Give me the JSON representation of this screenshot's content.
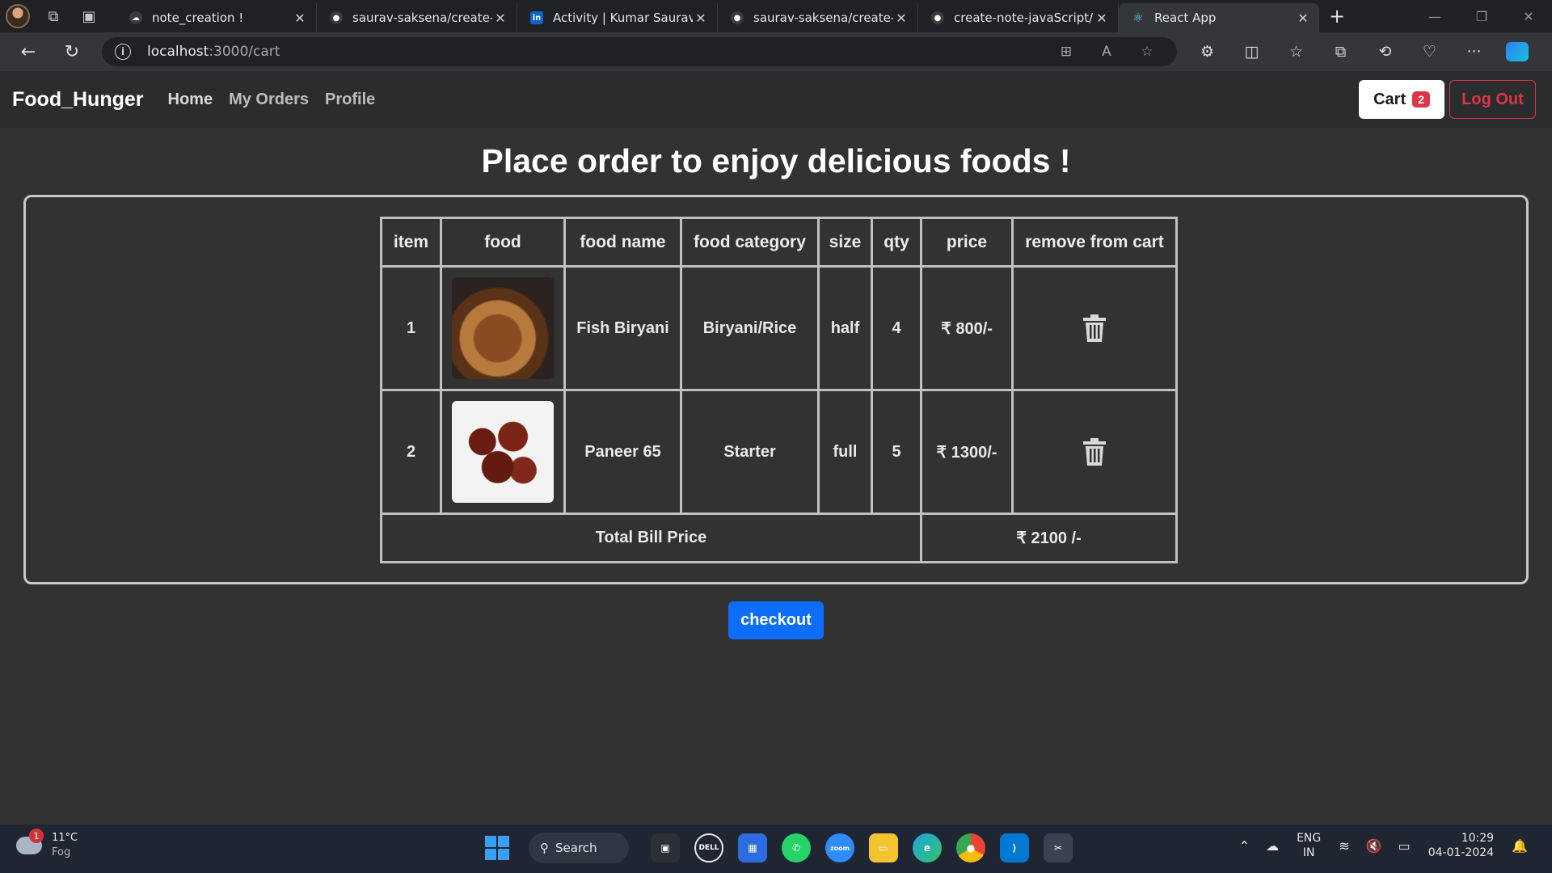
{
  "browser": {
    "tabs": [
      {
        "title": "note_creation !",
        "icon": "cloud-icon"
      },
      {
        "title": "saurav-saksena/create-nc",
        "icon": "github-icon"
      },
      {
        "title": "Activity | Kumar Saurav | l",
        "icon": "linkedin-icon"
      },
      {
        "title": "saurav-saksena/create-nc",
        "icon": "github-icon"
      },
      {
        "title": "create-note-javaScript/im",
        "icon": "github-icon"
      },
      {
        "title": "React App",
        "icon": "react-icon",
        "active": true
      }
    ],
    "url_host": "localhost",
    "url_rest": ":3000/cart"
  },
  "app": {
    "brand": "Food_Hunger",
    "nav": {
      "home": "Home",
      "orders": "My Orders",
      "profile": "Profile"
    },
    "cart_label": "Cart",
    "cart_count": "2",
    "logout_label": "Log Out",
    "headline": "Place order to enjoy delicious foods !",
    "table": {
      "headers": [
        "item",
        "food",
        "food name",
        "food category",
        "size",
        "qty",
        "price",
        "remove from cart"
      ],
      "rows": [
        {
          "item": "1",
          "image": "fish-biryani-photo",
          "name": "Fish Biryani",
          "category": "Biryani/Rice",
          "size": "half",
          "qty": "4",
          "price": "₹ 800/-"
        },
        {
          "item": "2",
          "image": "paneer-65-photo",
          "name": "Paneer 65",
          "category": "Starter",
          "size": "full",
          "qty": "5",
          "price": "₹ 1300/-"
        }
      ],
      "total_label": "Total Bill Price",
      "total_value": "₹ 2100 /-"
    },
    "checkout_label": "checkout",
    "colors": {
      "accent": "#0d6efd",
      "danger": "#dc3545",
      "page_bg": "#323232",
      "nav_bg": "#2b2c2e"
    }
  },
  "taskbar": {
    "weather_temp": "11°C",
    "weather_desc": "Fog",
    "weather_badge": "1",
    "search_label": "Search",
    "lang_top": "ENG",
    "lang_bottom": "IN",
    "time": "10:29",
    "date": "04-01-2024"
  }
}
